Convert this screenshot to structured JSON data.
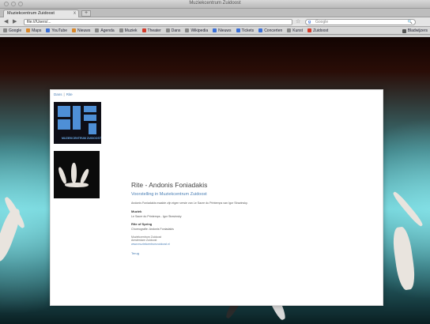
{
  "window": {
    "title": "Muziekcentrum Zuidoost"
  },
  "tab": {
    "label": "Muziekcentrum Zuidoost",
    "close": "x"
  },
  "toolbar": {
    "back": "◀",
    "forward": "▶",
    "url": "file:///Users/...",
    "star": "☆",
    "search_placeholder": "Google",
    "search_engine": "g",
    "search_icon": "🔍"
  },
  "bookmarks": [
    {
      "label": "Google",
      "color": "#888888"
    },
    {
      "label": "Maps",
      "color": "#d9872a"
    },
    {
      "label": "YouTube",
      "color": "#3a6fd8"
    },
    {
      "label": "Nieuws",
      "color": "#d9872a"
    },
    {
      "label": "Agenda",
      "color": "#888888"
    },
    {
      "label": "Muziek",
      "color": "#888888"
    },
    {
      "label": "Theater",
      "color": "#d43a2a"
    },
    {
      "label": "Dans",
      "color": "#888888"
    },
    {
      "label": "Wikipedia",
      "color": "#888888"
    },
    {
      "label": "Nieuws",
      "color": "#3a6fd8"
    },
    {
      "label": "Tickets",
      "color": "#3a6fd8"
    },
    {
      "label": "Concerten",
      "color": "#3a6fd8"
    },
    {
      "label": "Kunst",
      "color": "#888888"
    },
    {
      "label": "Zuidoost",
      "color": "#d43a2a"
    }
  ],
  "bookmarks_right": "Bladwijzers",
  "page": {
    "breadcrumb": [
      "Dans",
      "Rite"
    ],
    "logo_text": "MUZIEKCENTRUM ZUIDOOST",
    "title": "Rite - Andonis Foniadakis",
    "subtitle": "Voorstelling in Muziekcentrum Zuidoost",
    "intro": "Andonis Foniadakis maakte zijn eigen versie van Le Sacre du Printemps van Igor Stravinsky.",
    "section1_title": "Muziek",
    "section1_text": "Le Sacre du Printemps - Igor Stravinsky",
    "section2_title": "Rite of Spring",
    "section2_text": "Choreografie: Andonis Foniadakis",
    "meta_lines": [
      "Muziekcentrum Zuidoost",
      "Amsterdam Zuidoost"
    ],
    "meta_link": "www.muziekcentrumzuidoost.nl",
    "back_link": "Terug"
  }
}
